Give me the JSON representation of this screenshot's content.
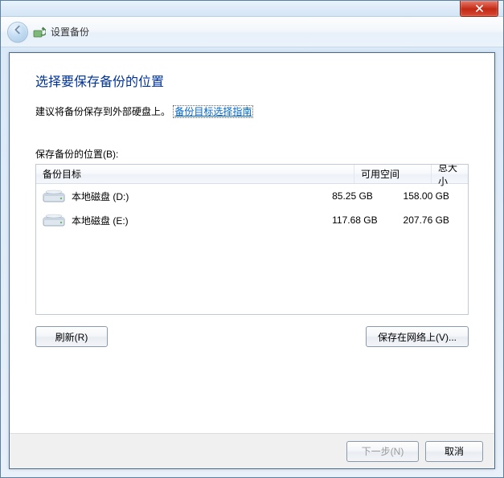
{
  "window": {
    "title": "设置备份"
  },
  "page": {
    "heading": "选择要保存备份的位置",
    "recommend_text": "建议将备份保存到外部硬盘上。",
    "guide_link": "备份目标选择指南",
    "location_label": "保存备份的位置(B):"
  },
  "table": {
    "columns": {
      "target": "备份目标",
      "free": "可用空间",
      "total": "总大小"
    },
    "rows": [
      {
        "name": "本地磁盘 (D:)",
        "free": "85.25 GB",
        "total": "158.00 GB"
      },
      {
        "name": "本地磁盘 (E:)",
        "free": "117.68 GB",
        "total": "207.76 GB"
      }
    ]
  },
  "buttons": {
    "refresh": "刷新(R)",
    "save_network": "保存在网络上(V)...",
    "next": "下一步(N)",
    "cancel": "取消"
  }
}
